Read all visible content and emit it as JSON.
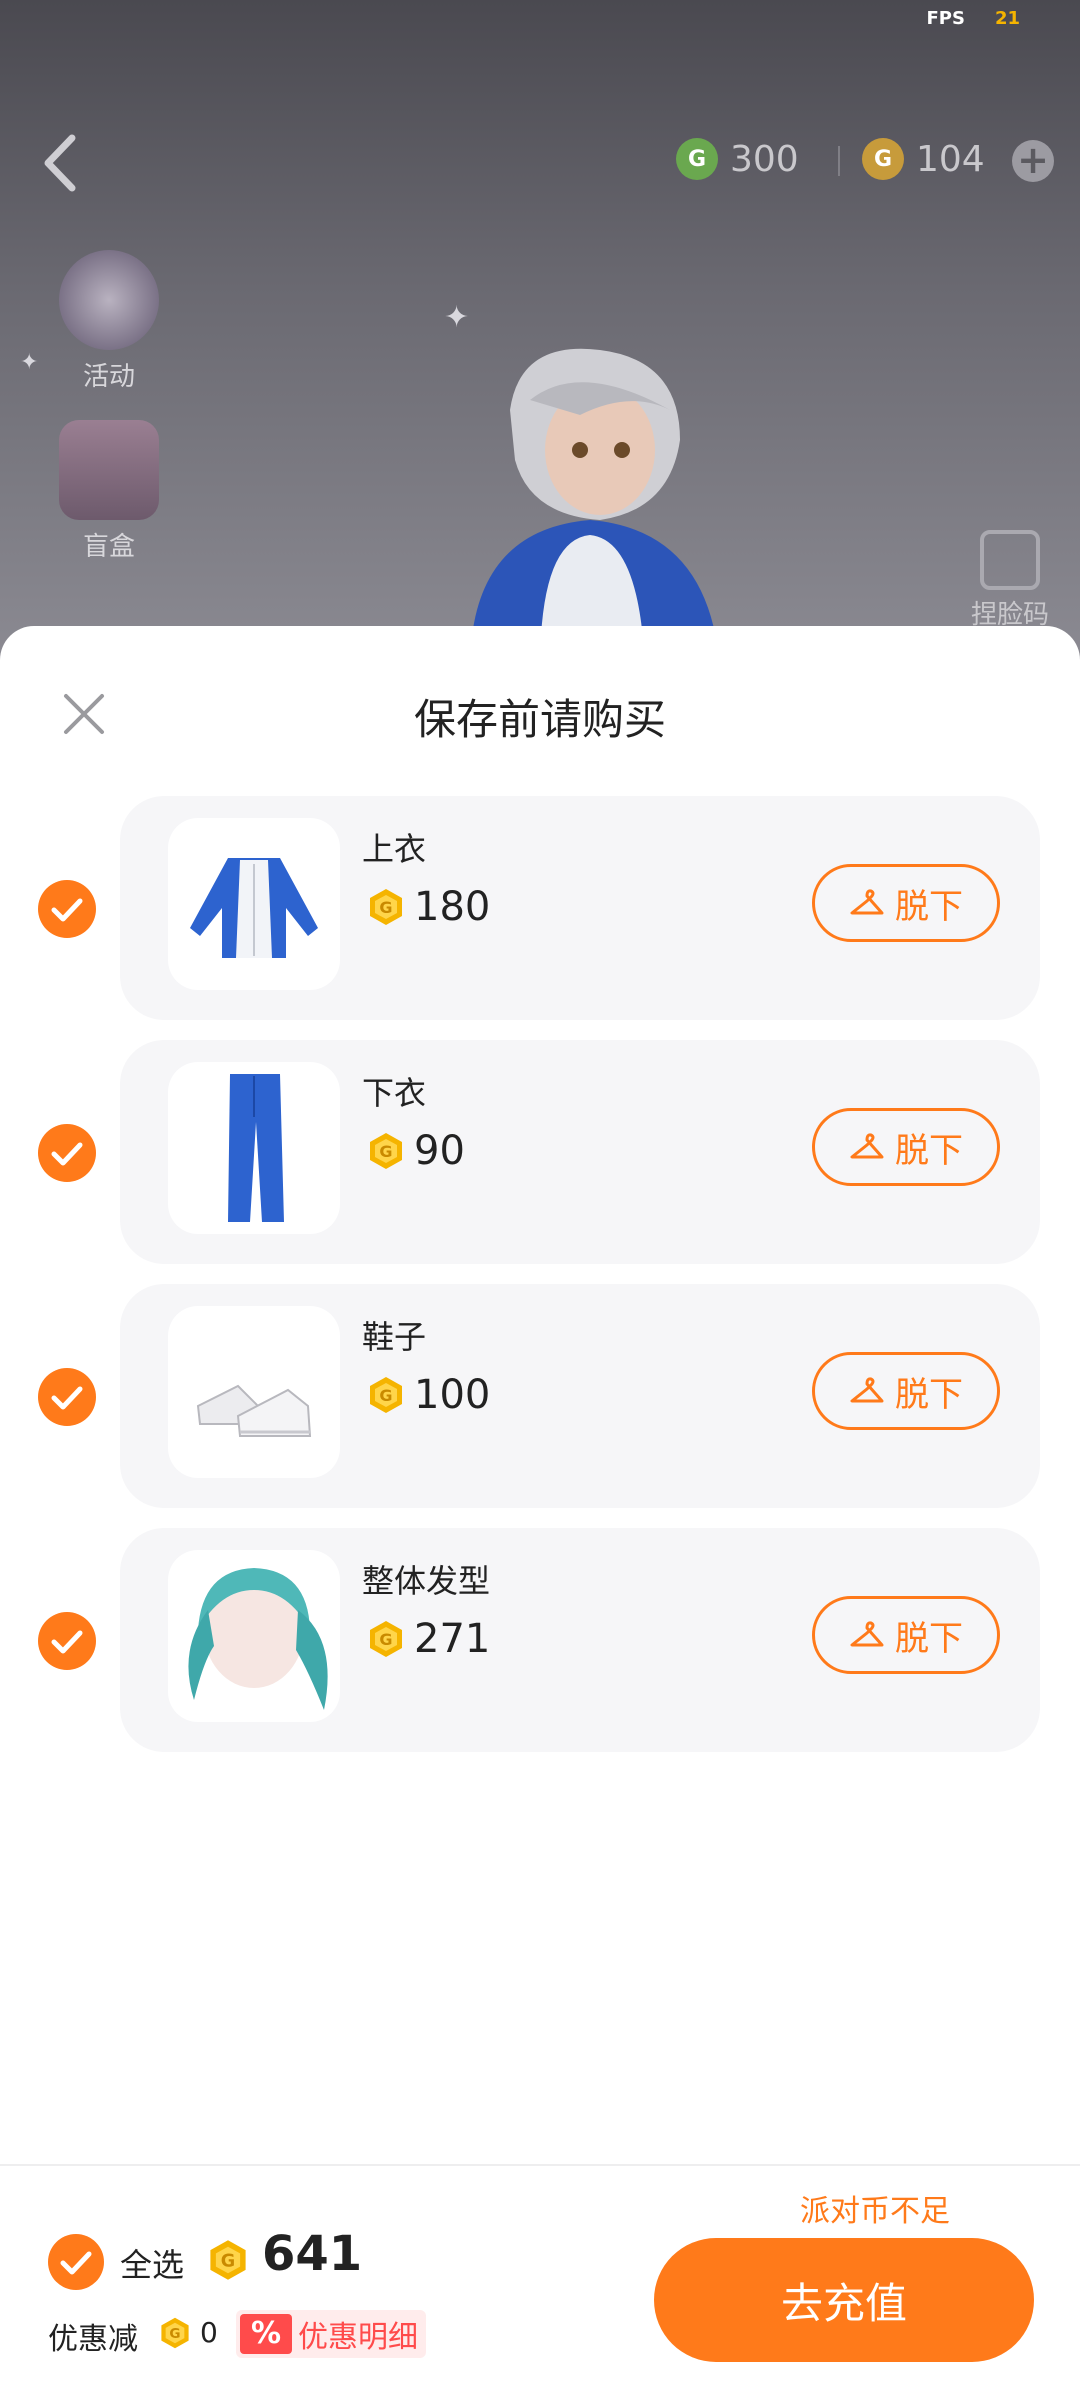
{
  "status": {
    "fps_label": "FPS",
    "fps_value": "21"
  },
  "topbar": {
    "green_currency": "300",
    "gold_currency": "104",
    "add_label": "+"
  },
  "side_menu": {
    "activity": "活动",
    "blind_box": "盲盒",
    "face_code": "捏脸码"
  },
  "sheet": {
    "title": "保存前请购买",
    "items": [
      {
        "name": "上衣",
        "price": "180",
        "action": "脱下",
        "checked": true
      },
      {
        "name": "下衣",
        "price": "90",
        "action": "脱下",
        "checked": true
      },
      {
        "name": "鞋子",
        "price": "100",
        "action": "脱下",
        "checked": true
      },
      {
        "name": "整体发型",
        "price": "271",
        "action": "脱下",
        "checked": true
      }
    ]
  },
  "footer": {
    "insufficient": "派对币不足",
    "select_all": "全选",
    "total": "641",
    "discount_label": "优惠减",
    "discount_value": "0",
    "promo_badge": "%",
    "promo_detail": "优惠明细",
    "recharge": "去充值"
  },
  "colors": {
    "accent": "#ff7a1a",
    "coin": "#f5b400",
    "promo": "#ff4b4b"
  },
  "icons": {
    "back": "chevron-left-icon",
    "close": "close-icon",
    "check": "check-icon",
    "hanger": "hanger-icon",
    "coin": "party-coin-icon"
  }
}
